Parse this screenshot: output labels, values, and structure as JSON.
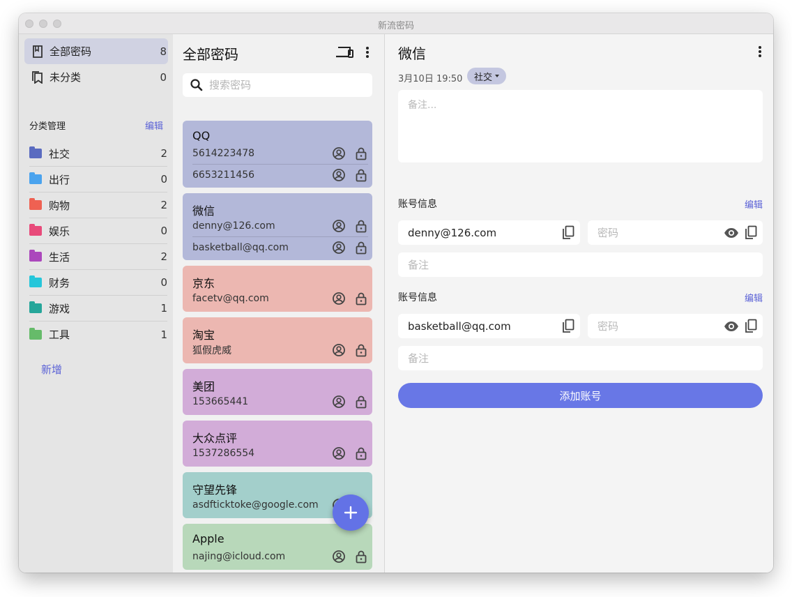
{
  "window": {
    "title": "新流密码"
  },
  "sidebar": {
    "all": {
      "label": "全部密码",
      "count": "8"
    },
    "uncategorized": {
      "label": "未分类",
      "count": "0"
    },
    "section_title": "分类管理",
    "section_edit": "编辑",
    "categories": [
      {
        "label": "社交",
        "count": "2",
        "color": "#5a6bc0"
      },
      {
        "label": "出行",
        "count": "0",
        "color": "#4aa3ee"
      },
      {
        "label": "购物",
        "count": "2",
        "color": "#ef6152"
      },
      {
        "label": "娱乐",
        "count": "0",
        "color": "#e84a7a"
      },
      {
        "label": "生活",
        "count": "2",
        "color": "#ab47bc"
      },
      {
        "label": "财务",
        "count": "0",
        "color": "#26c6da"
      },
      {
        "label": "游戏",
        "count": "1",
        "color": "#26a69a"
      },
      {
        "label": "工具",
        "count": "1",
        "color": "#66bb6a"
      }
    ],
    "add_label": "新增"
  },
  "list": {
    "title": "全部密码",
    "search_placeholder": "搜索密码",
    "cards": [
      {
        "name": "QQ",
        "color": "#b3b8d9",
        "accounts": [
          "5614223478",
          "6653211456"
        ]
      },
      {
        "name": "微信",
        "color": "#b3b8d9",
        "accounts": [
          "denny@126.com",
          "basketball@qq.com"
        ]
      },
      {
        "name": "京东",
        "color": "#ecb7b1",
        "accounts": [
          "facetv@qq.com"
        ]
      },
      {
        "name": "淘宝",
        "color": "#ecb7b1",
        "accounts": [
          "狐假虎威"
        ]
      },
      {
        "name": "美团",
        "color": "#d2acd8",
        "accounts": [
          "153665441"
        ]
      },
      {
        "name": "大众点评",
        "color": "#d2acd8",
        "accounts": [
          "1537286554"
        ]
      },
      {
        "name": "守望先锋",
        "color": "#a3cfcb",
        "accounts": [
          "asdfticktoke@google.com"
        ]
      },
      {
        "name": "Apple",
        "color": "#b8d8ba",
        "accounts": [
          "najing@icloud.com"
        ]
      }
    ]
  },
  "detail": {
    "title": "微信",
    "date": "3月10日 19:50",
    "tag": "社交",
    "note_placeholder": "备注...",
    "accounts": [
      {
        "header": "账号信息",
        "edit": "编辑",
        "username": "denny@126.com",
        "password_placeholder": "密码",
        "note_placeholder": "备注"
      },
      {
        "header": "账号信息",
        "edit": "编辑",
        "username": "basketball@qq.com",
        "password_placeholder": "密码",
        "note_placeholder": "备注"
      }
    ],
    "add_button": "添加账号"
  }
}
